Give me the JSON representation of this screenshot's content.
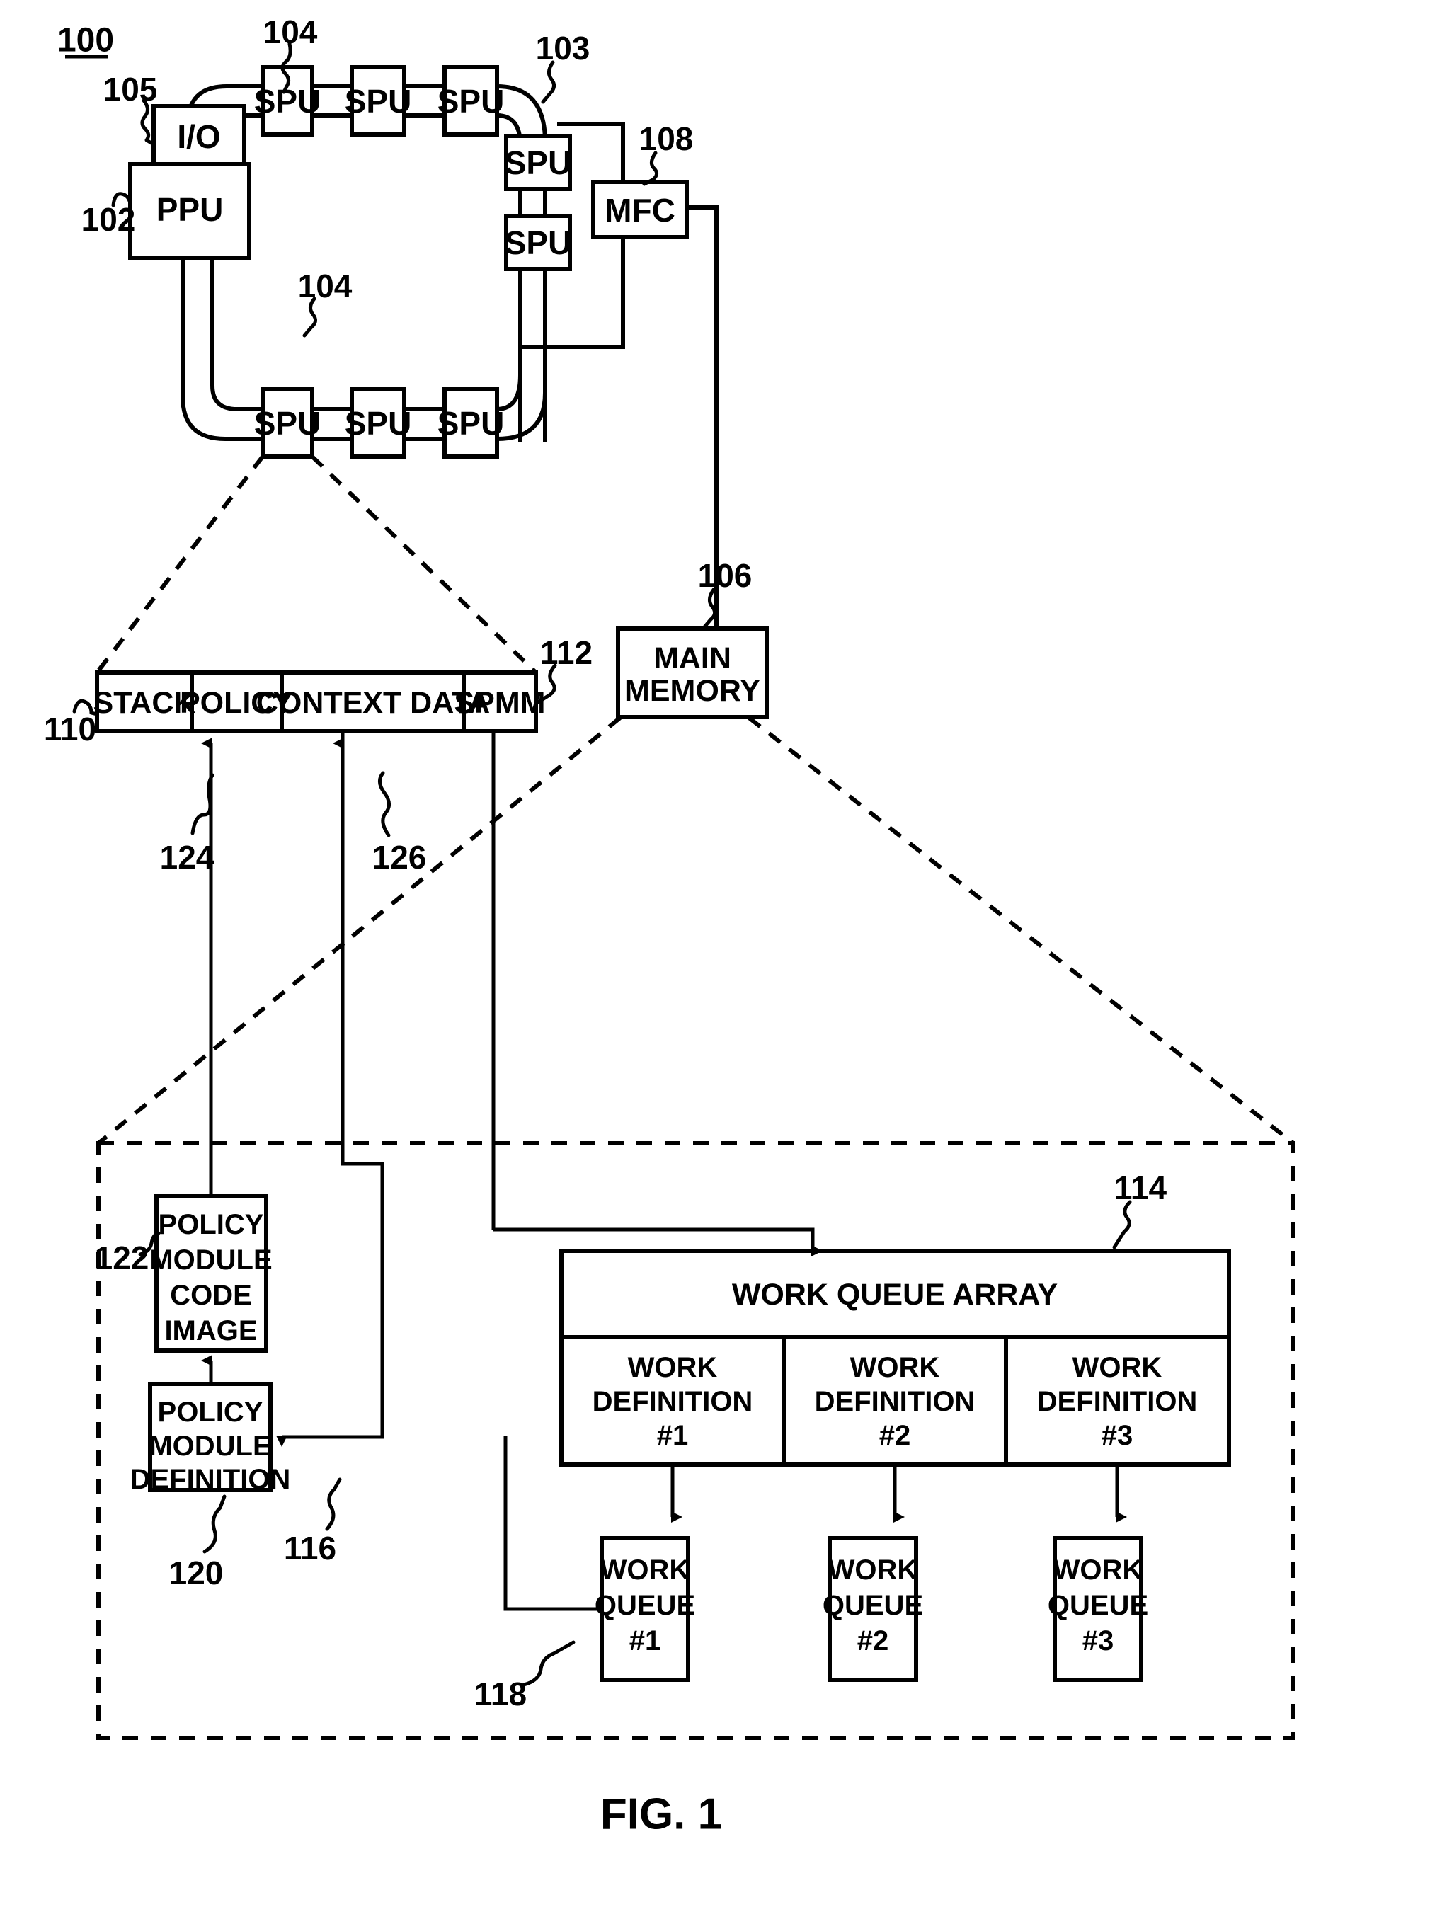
{
  "figure": {
    "number": "100",
    "caption": "FIG. 1"
  },
  "processor_ring": {
    "ppu": {
      "label": "PPU",
      "ref": "102"
    },
    "io": {
      "label": "I/O",
      "ref": "105"
    },
    "bus_ref": "103",
    "mfc": {
      "label": "MFC",
      "ref": "108"
    },
    "main_memory": {
      "label_line1": "MAIN",
      "label_line2": "MEMORY",
      "ref": "106"
    },
    "spu_ref_top": "104",
    "spu_ref_bottom": "104",
    "spus": [
      {
        "label": "SPU",
        "position": "top-1"
      },
      {
        "label": "SPU",
        "position": "top-2"
      },
      {
        "label": "SPU",
        "position": "top-3"
      },
      {
        "label": "SPU",
        "position": "right-1"
      },
      {
        "label": "SPU",
        "position": "right-2"
      },
      {
        "label": "SPU",
        "position": "bottom-1"
      },
      {
        "label": "SPU",
        "position": "bottom-2"
      },
      {
        "label": "SPU",
        "position": "bottom-3"
      }
    ]
  },
  "local_store": {
    "ref": "110",
    "segments": [
      {
        "label": "STACK",
        "ref": null
      },
      {
        "label": "POLICY",
        "ref": "124"
      },
      {
        "label": "CONTEXT DATA",
        "ref": "126"
      },
      {
        "label": "SPMM",
        "ref": "112"
      }
    ]
  },
  "memory_detail": {
    "policy_module_code_image": {
      "lines": [
        "POLICY",
        "MODULE",
        "CODE",
        "IMAGE"
      ],
      "ref": "122"
    },
    "policy_module_definition": {
      "lines": [
        "POLICY",
        "MODULE",
        "DEFINITION"
      ],
      "ref": "120"
    },
    "work_queue_array": {
      "title": "WORK QUEUE ARRAY",
      "ref": "114",
      "work_definitions": [
        {
          "lines": [
            "WORK",
            "DEFINITION",
            "#1"
          ],
          "ref": "116"
        },
        {
          "lines": [
            "WORK",
            "DEFINITION",
            "#2"
          ],
          "ref": null
        },
        {
          "lines": [
            "WORK",
            "DEFINITION",
            "#3"
          ],
          "ref": null
        }
      ]
    },
    "work_queues": [
      {
        "lines": [
          "WORK",
          "QUEUE",
          "#1"
        ],
        "ref": "118"
      },
      {
        "lines": [
          "WORK",
          "QUEUE",
          "#2"
        ],
        "ref": null
      },
      {
        "lines": [
          "WORK",
          "QUEUE",
          "#3"
        ],
        "ref": null
      }
    ]
  },
  "colors": {
    "ink": "#000000",
    "paper": "#ffffff"
  }
}
